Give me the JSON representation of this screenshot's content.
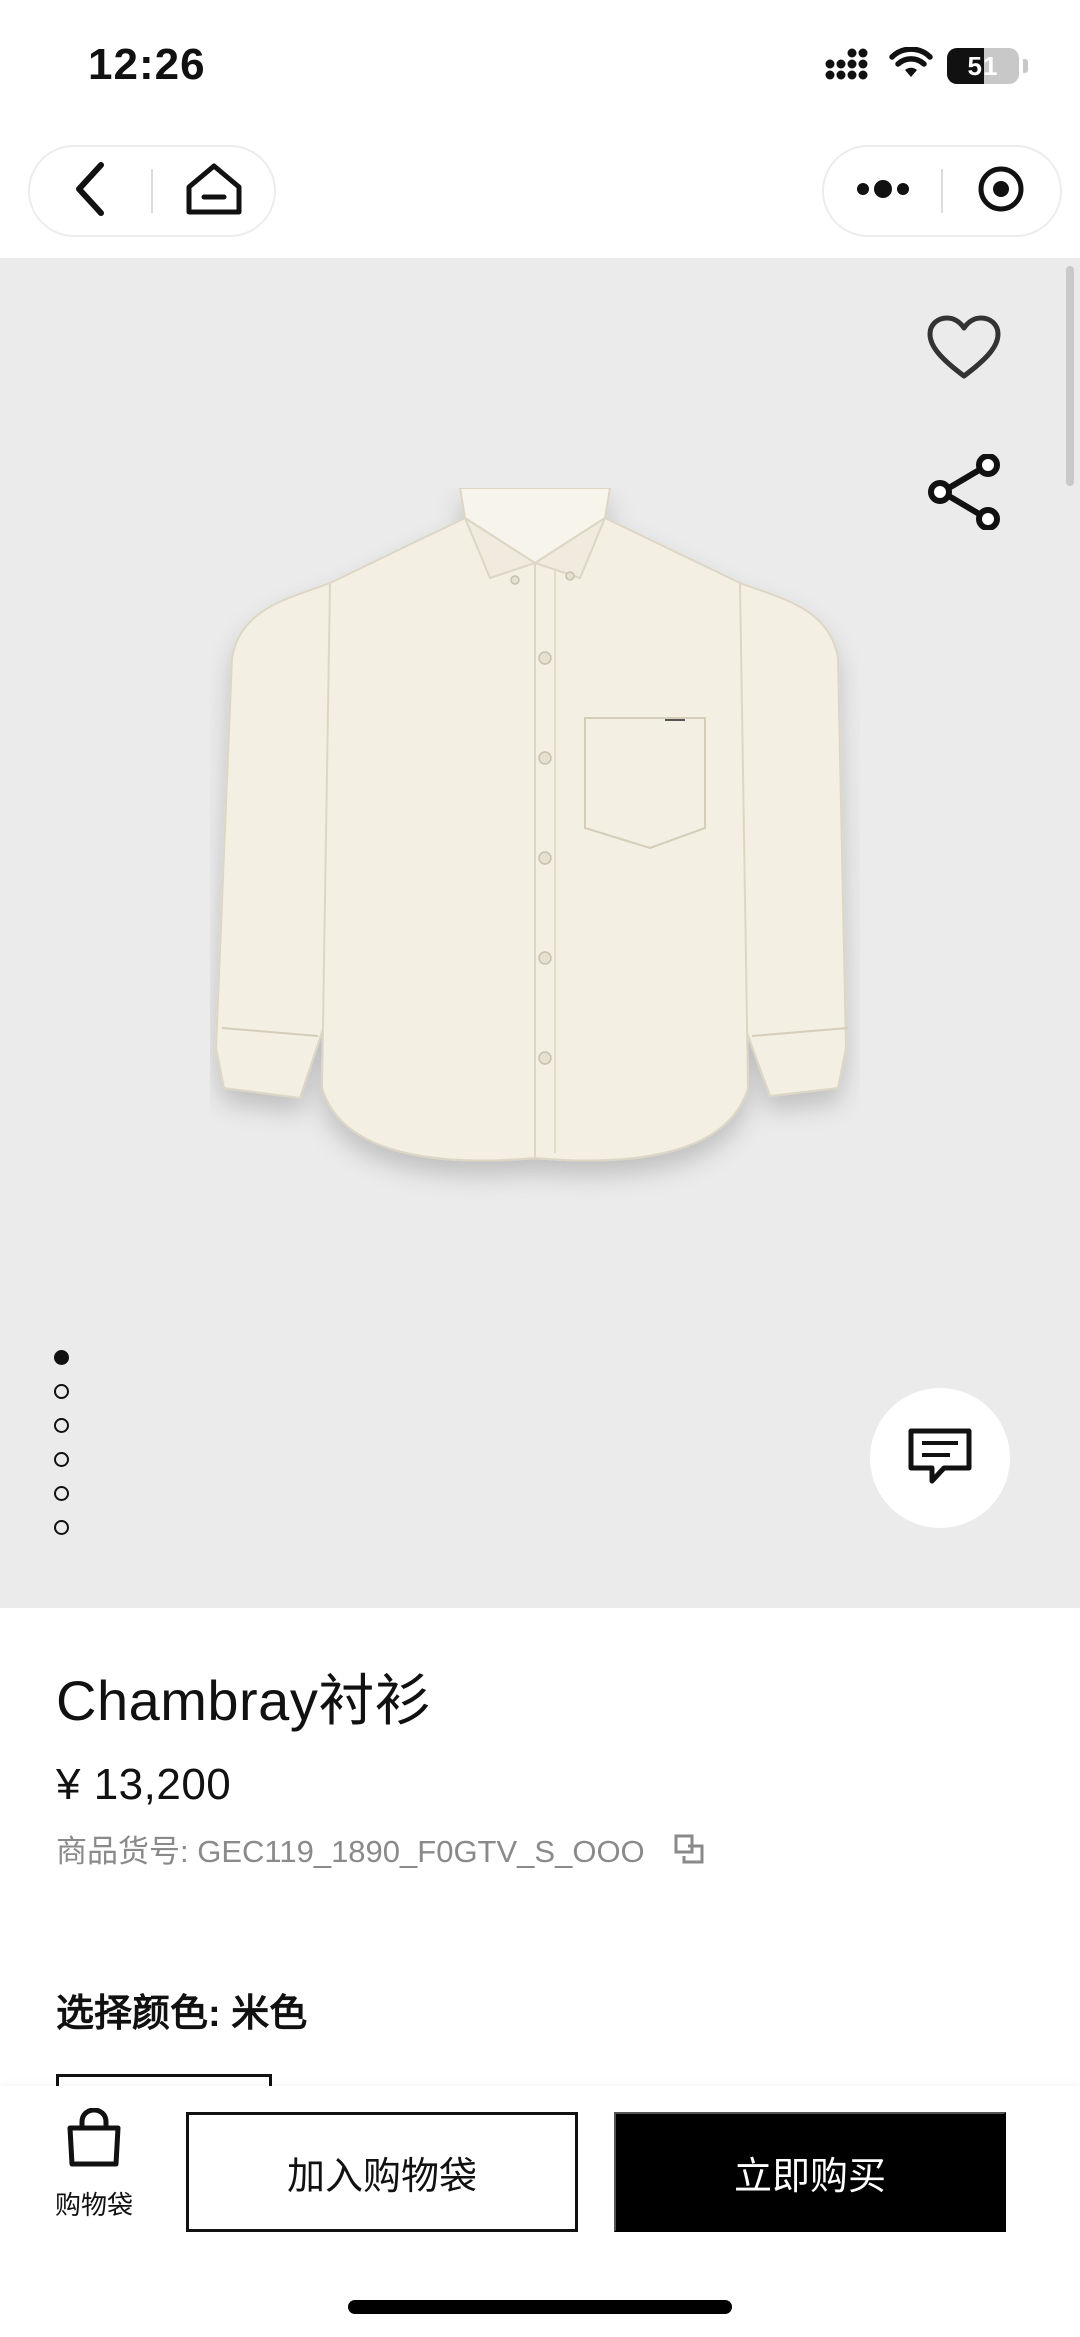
{
  "status_bar": {
    "time": "12:26",
    "battery": "51",
    "battery_level": 0.51
  },
  "nav": {
    "back_icon": "chevron-left-icon",
    "home_icon": "home-icon",
    "more_icon": "more-dots-icon",
    "close_icon": "target-close-icon"
  },
  "gallery": {
    "total_images": 6,
    "active_index": 0
  },
  "product": {
    "title": "Chambray衬衫",
    "price": "¥ 13,200",
    "sku": "商品货号: GEC119_1890_F0GTV_S_OOO",
    "color_label": "选择颜色: 米色"
  },
  "actions": {
    "bag_label": "购物袋",
    "add_to_bag": "加入购物袋",
    "buy_now": "立即购买"
  },
  "colors": {
    "image_bg": "#ebebeb",
    "primary": "#000000",
    "muted_text": "#8a8a8a",
    "shirt": "#f3efe3"
  }
}
